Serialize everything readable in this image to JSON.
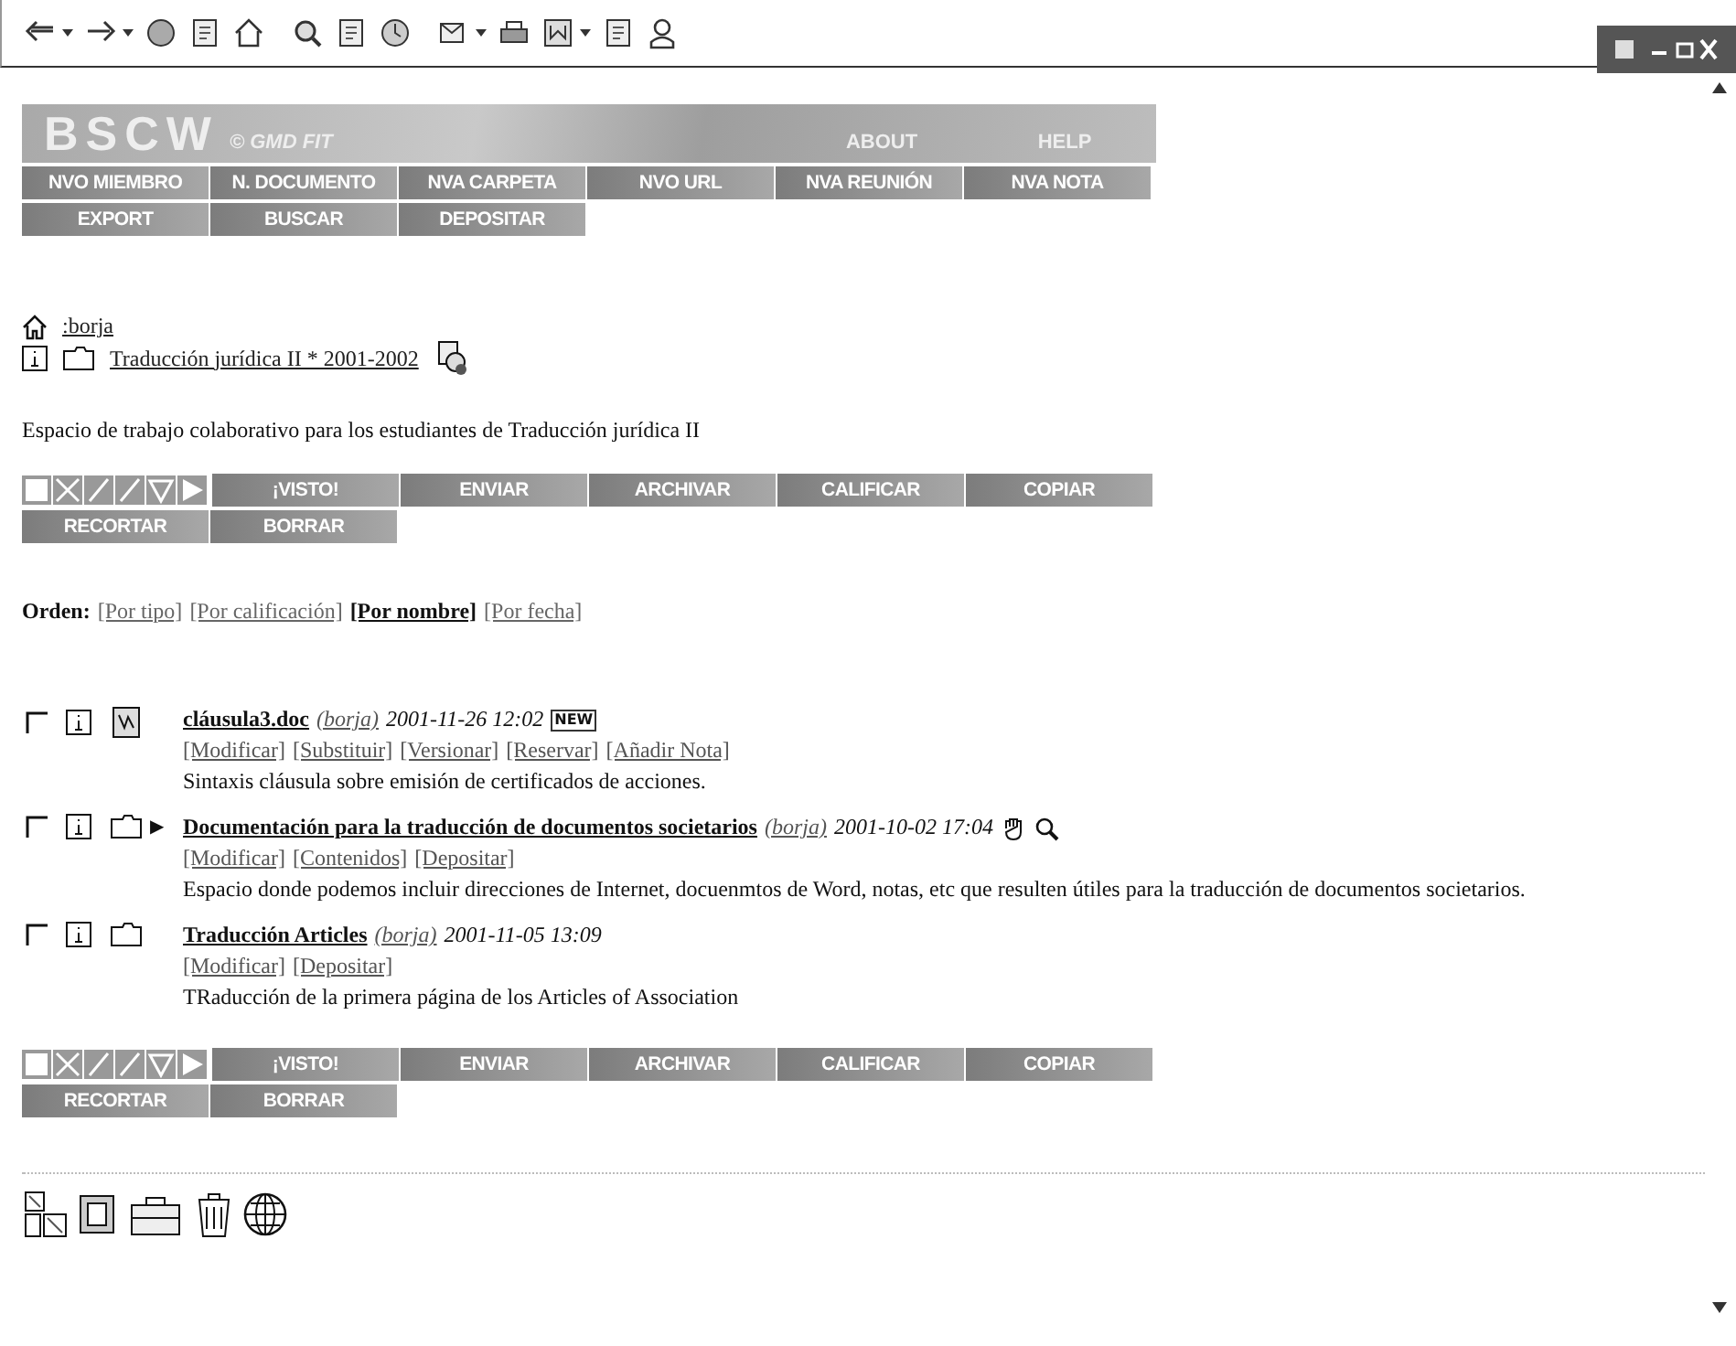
{
  "banner": {
    "logo": "BSCW",
    "credit": "© GMD FIT",
    "links": [
      "ABOUT",
      "HELP"
    ]
  },
  "menu": [
    [
      "NVO MIEMBRO",
      "N. DOCUMENTO",
      "NVA CARPETA",
      "NVO URL",
      "NVA REUNIÓN",
      "NVA NOTA"
    ],
    [
      "EXPORT",
      "BUSCAR",
      "DEPOSITAR"
    ]
  ],
  "breadcrumb": {
    "home": ":borja",
    "folder": "Traducción jurídica II * 2001-2002"
  },
  "description": "Espacio de trabajo colaborativo para los estudiantes de Traducción jurídica II",
  "actions_top": [
    [
      "¡VISTO!",
      "ENVIAR",
      "ARCHIVAR",
      "CALIFICAR",
      "COPIAR"
    ],
    [
      "RECORTAR",
      "BORRAR"
    ]
  ],
  "sort": {
    "label": "Orden:",
    "options": [
      {
        "label": "[Por tipo]",
        "selected": false
      },
      {
        "label": "[Por calificación]",
        "selected": false
      },
      {
        "label": "[Por nombre]",
        "selected": true
      },
      {
        "label": "[Por fecha]",
        "selected": false
      }
    ]
  },
  "items": [
    {
      "kind": "document",
      "checked": false,
      "name": "cláusula3.doc",
      "owner": "(borja)",
      "date": "2001-11-26 12:02",
      "badge": "NEW",
      "locked": false,
      "actions": [
        "[Modificar]",
        "[Substituir]",
        "[Versionar]",
        "[Reservar]",
        "[Añadir Nota]"
      ],
      "description": "Sintaxis cláusula sobre emisión de certificados de acciones."
    },
    {
      "kind": "folder",
      "checked": false,
      "expander": "▶",
      "name": "Documentación para la traducción de documentos societarios",
      "owner": "(borja)",
      "date": "2001-10-02 17:04",
      "locked": true,
      "actions": [
        "[Modificar]",
        "[Contenidos]",
        "[Depositar]"
      ],
      "description": "Espacio donde podemos incluir direcciones de Internet, docuenmtos de Word, notas, etc que resulten útiles para la traducción de documentos societarios."
    },
    {
      "kind": "folder",
      "checked": false,
      "name": "Traducción Articles",
      "owner": "(borja)",
      "date": "2001-11-05 13:09",
      "locked": false,
      "actions": [
        "[Modificar]",
        "[Depositar]"
      ],
      "description": "TRaducción de la primera página de los Articles of Association"
    }
  ],
  "actions_bottom": [
    [
      "¡VISTO!",
      "ENVIAR",
      "ARCHIVAR",
      "CALIFICAR",
      "COPIAR"
    ],
    [
      "RECORTAR",
      "BORRAR"
    ]
  ]
}
